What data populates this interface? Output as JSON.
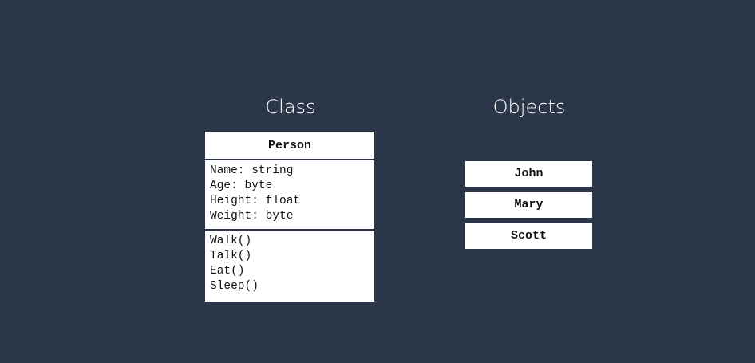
{
  "headings": {
    "class_title": "Class",
    "objects_title": "Objects"
  },
  "class_box": {
    "name": "Person",
    "attributes": [
      "Name: string",
      "Age: byte",
      "Height: float",
      "Weight: byte"
    ],
    "methods": [
      "Walk()",
      "Talk()",
      "Eat()",
      "Sleep()"
    ]
  },
  "objects": [
    "John",
    "Mary",
    "Scott"
  ],
  "colors": {
    "background": "#2b3749",
    "box": "#ffffff",
    "text": "#111111",
    "heading": "#ffffff"
  }
}
